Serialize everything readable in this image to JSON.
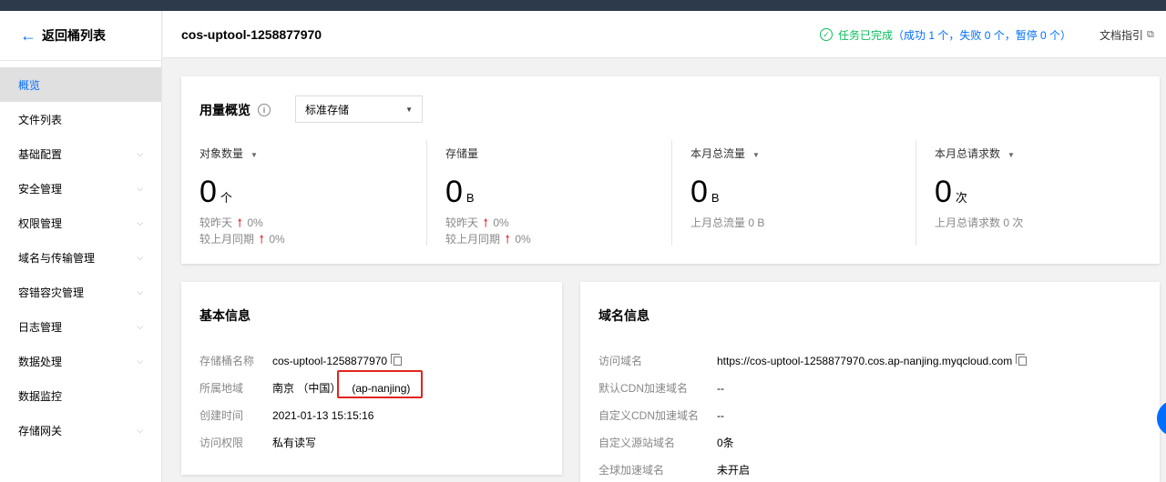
{
  "sidebar": {
    "back_label": "返回桶列表",
    "items": [
      {
        "label": "概览",
        "active": true,
        "expandable": false
      },
      {
        "label": "文件列表",
        "expandable": false
      },
      {
        "label": "基础配置",
        "expandable": true
      },
      {
        "label": "安全管理",
        "expandable": true
      },
      {
        "label": "权限管理",
        "expandable": true
      },
      {
        "label": "域名与传输管理",
        "expandable": true
      },
      {
        "label": "容错容灾管理",
        "expandable": true
      },
      {
        "label": "日志管理",
        "expandable": true
      },
      {
        "label": "数据处理",
        "expandable": true
      },
      {
        "label": "数据监控",
        "expandable": false
      },
      {
        "label": "存储网关",
        "expandable": true
      }
    ]
  },
  "header": {
    "title": "cos-uptool-1258877970",
    "status_done": "任务已完成",
    "status_detail": "（成功 1 个，失败 0 个，暂停 0 个）",
    "doc_link": "文档指引"
  },
  "usage": {
    "title": "用量概览",
    "storage_select": "标准存储",
    "metrics": [
      {
        "label": "对象数量",
        "dropdown": true,
        "value": "0",
        "unit": "个",
        "cmp1_label": "较昨天",
        "cmp1_value": "0%",
        "cmp2_label": "较上月同期",
        "cmp2_value": "0%"
      },
      {
        "label": "存储量",
        "dropdown": false,
        "value": "0",
        "unit": "B",
        "cmp1_label": "较昨天",
        "cmp1_value": "0%",
        "cmp2_label": "较上月同期",
        "cmp2_value": "0%"
      },
      {
        "label": "本月总流量",
        "dropdown": true,
        "value": "0",
        "unit": "B",
        "last_month": "上月总流量 0 B"
      },
      {
        "label": "本月总请求数",
        "dropdown": true,
        "value": "0",
        "unit": "次",
        "last_month": "上月总请求数 0 次"
      }
    ]
  },
  "basic": {
    "title": "基本信息",
    "rows": [
      {
        "key": "存储桶名称",
        "value": "cos-uptool-1258877970"
      },
      {
        "key": "所属地域",
        "value": "南京 （中国）",
        "extra": "(ap-nanjing)"
      },
      {
        "key": "创建时间",
        "value": "2021-01-13 15:15:16"
      },
      {
        "key": "访问权限",
        "value": "私有读写"
      }
    ]
  },
  "domain": {
    "title": "域名信息",
    "rows": [
      {
        "key": "访问域名",
        "value": "https://cos-uptool-1258877970.cos.ap-nanjing.myqcloud.com"
      },
      {
        "key": "默认CDN加速域名",
        "value": "--"
      },
      {
        "key": "自定义CDN加速域名",
        "value": "--"
      },
      {
        "key": "自定义源站域名",
        "value": "0条"
      },
      {
        "key": "全球加速域名",
        "value": "未开启"
      }
    ]
  },
  "colors": {
    "accent": "#006eff",
    "success": "#0abf5b",
    "up_arrow": "#e54545",
    "highlight": "#e1251b"
  },
  "icons": [
    "back-arrow-icon",
    "chevron-down-icon",
    "check-circle-icon",
    "external-link-icon",
    "info-icon",
    "caret-down-icon",
    "arrow-up-icon",
    "copy-icon"
  ]
}
